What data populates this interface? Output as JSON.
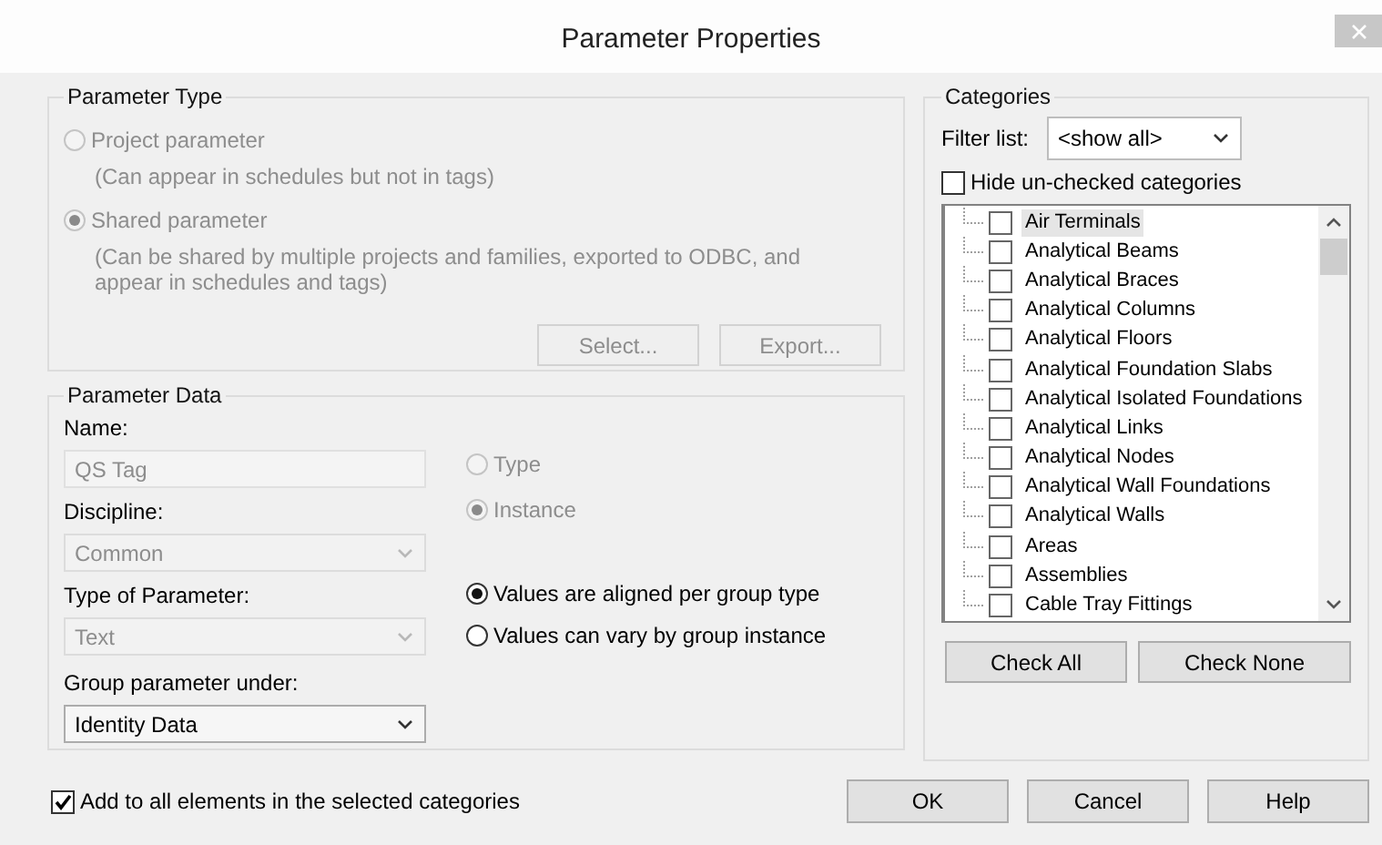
{
  "window": {
    "title": "Parameter Properties"
  },
  "parameter_type": {
    "legend": "Parameter Type",
    "options": [
      {
        "label": "Project parameter",
        "description": "(Can appear in schedules but not in tags)",
        "selected": false,
        "disabled": true
      },
      {
        "label": "Shared parameter",
        "description": "(Can be shared by multiple projects and families, exported to ODBC, and appear in schedules and tags)",
        "selected": true,
        "disabled": true
      }
    ],
    "buttons": [
      {
        "label": "Select...",
        "disabled": true
      },
      {
        "label": "Export...",
        "disabled": true
      }
    ]
  },
  "parameter_data": {
    "legend": "Parameter Data",
    "fields": [
      {
        "kind": "text",
        "label": "Name:",
        "value": "QS Tag",
        "disabled": true
      },
      {
        "kind": "dropdown",
        "label": "Discipline:",
        "value": "Common",
        "disabled": true
      },
      {
        "kind": "dropdown",
        "label": "Type of Parameter:",
        "value": "Text",
        "disabled": true
      },
      {
        "kind": "dropdown",
        "label": "Group parameter under:",
        "value": "Identity Data",
        "disabled": false
      }
    ],
    "type_instance": [
      {
        "label": "Type",
        "selected": false,
        "disabled": true
      },
      {
        "label": "Instance",
        "selected": true,
        "disabled": true
      }
    ],
    "group_values": [
      {
        "label": "Values are aligned per group type",
        "selected": true,
        "disabled": false
      },
      {
        "label": "Values can vary by group instance",
        "selected": false,
        "disabled": false
      }
    ]
  },
  "categories": {
    "legend": "Categories",
    "filter": {
      "label": "Filter list:",
      "value": "<show all>"
    },
    "hide_unchecked": {
      "label": "Hide un-checked categories",
      "checked": false
    },
    "items": [
      {
        "label": "Air Terminals",
        "checked": false,
        "selected": true
      },
      {
        "label": "Analytical Beams",
        "checked": false,
        "selected": false
      },
      {
        "label": "Analytical Braces",
        "checked": false,
        "selected": false
      },
      {
        "label": "Analytical Columns",
        "checked": false,
        "selected": false
      },
      {
        "label": "Analytical Floors",
        "checked": false,
        "selected": false
      },
      {
        "label": "Analytical Foundation Slabs",
        "checked": false,
        "selected": false
      },
      {
        "label": "Analytical Isolated Foundations",
        "checked": false,
        "selected": false
      },
      {
        "label": "Analytical Links",
        "checked": false,
        "selected": false
      },
      {
        "label": "Analytical Nodes",
        "checked": false,
        "selected": false
      },
      {
        "label": "Analytical Wall Foundations",
        "checked": false,
        "selected": false
      },
      {
        "label": "Analytical Walls",
        "checked": false,
        "selected": false
      },
      {
        "label": "Areas",
        "checked": false,
        "selected": false
      },
      {
        "label": "Assemblies",
        "checked": false,
        "selected": false
      },
      {
        "label": "Cable Tray Fittings",
        "checked": false,
        "selected": false
      }
    ],
    "buttons": [
      "Check All",
      "Check None"
    ]
  },
  "add_to_all": {
    "label": "Add to all elements in the selected categories",
    "checked": true
  },
  "buttons": [
    "OK",
    "Cancel",
    "Help"
  ]
}
